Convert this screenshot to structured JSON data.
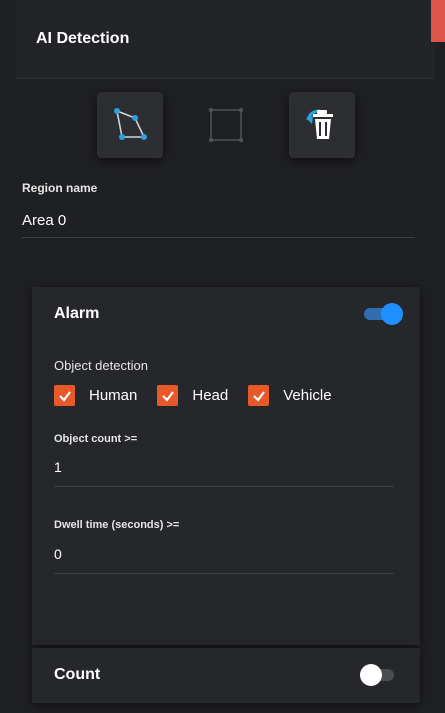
{
  "header": {
    "title": "AI Detection",
    "accent_color": "#e0554b"
  },
  "toolbar": {
    "tools": [
      {
        "name": "polygon-draw",
        "icon": "polygon-icon",
        "state": "active"
      },
      {
        "name": "rectangle-draw",
        "icon": "rectangle-icon",
        "state": "disabled"
      },
      {
        "name": "delete-region",
        "icon": "trash-icon",
        "state": "active"
      }
    ]
  },
  "region": {
    "label": "Region name",
    "value": "Area 0"
  },
  "alarm": {
    "title": "Alarm",
    "enabled": true,
    "object_detection_label": "Object detection",
    "objects": [
      {
        "label": "Human",
        "checked": true
      },
      {
        "label": "Head",
        "checked": true
      },
      {
        "label": "Vehicle",
        "checked": true
      }
    ],
    "object_count_label": "Object count >=",
    "object_count_value": "1",
    "dwell_time_label": "Dwell time (seconds) >=",
    "dwell_time_value": "0"
  },
  "count": {
    "title": "Count",
    "enabled": false
  },
  "colors": {
    "checkbox": "#e8592a",
    "toggle_on": "#1e90ff",
    "icon_accent": "#29a3e0"
  }
}
